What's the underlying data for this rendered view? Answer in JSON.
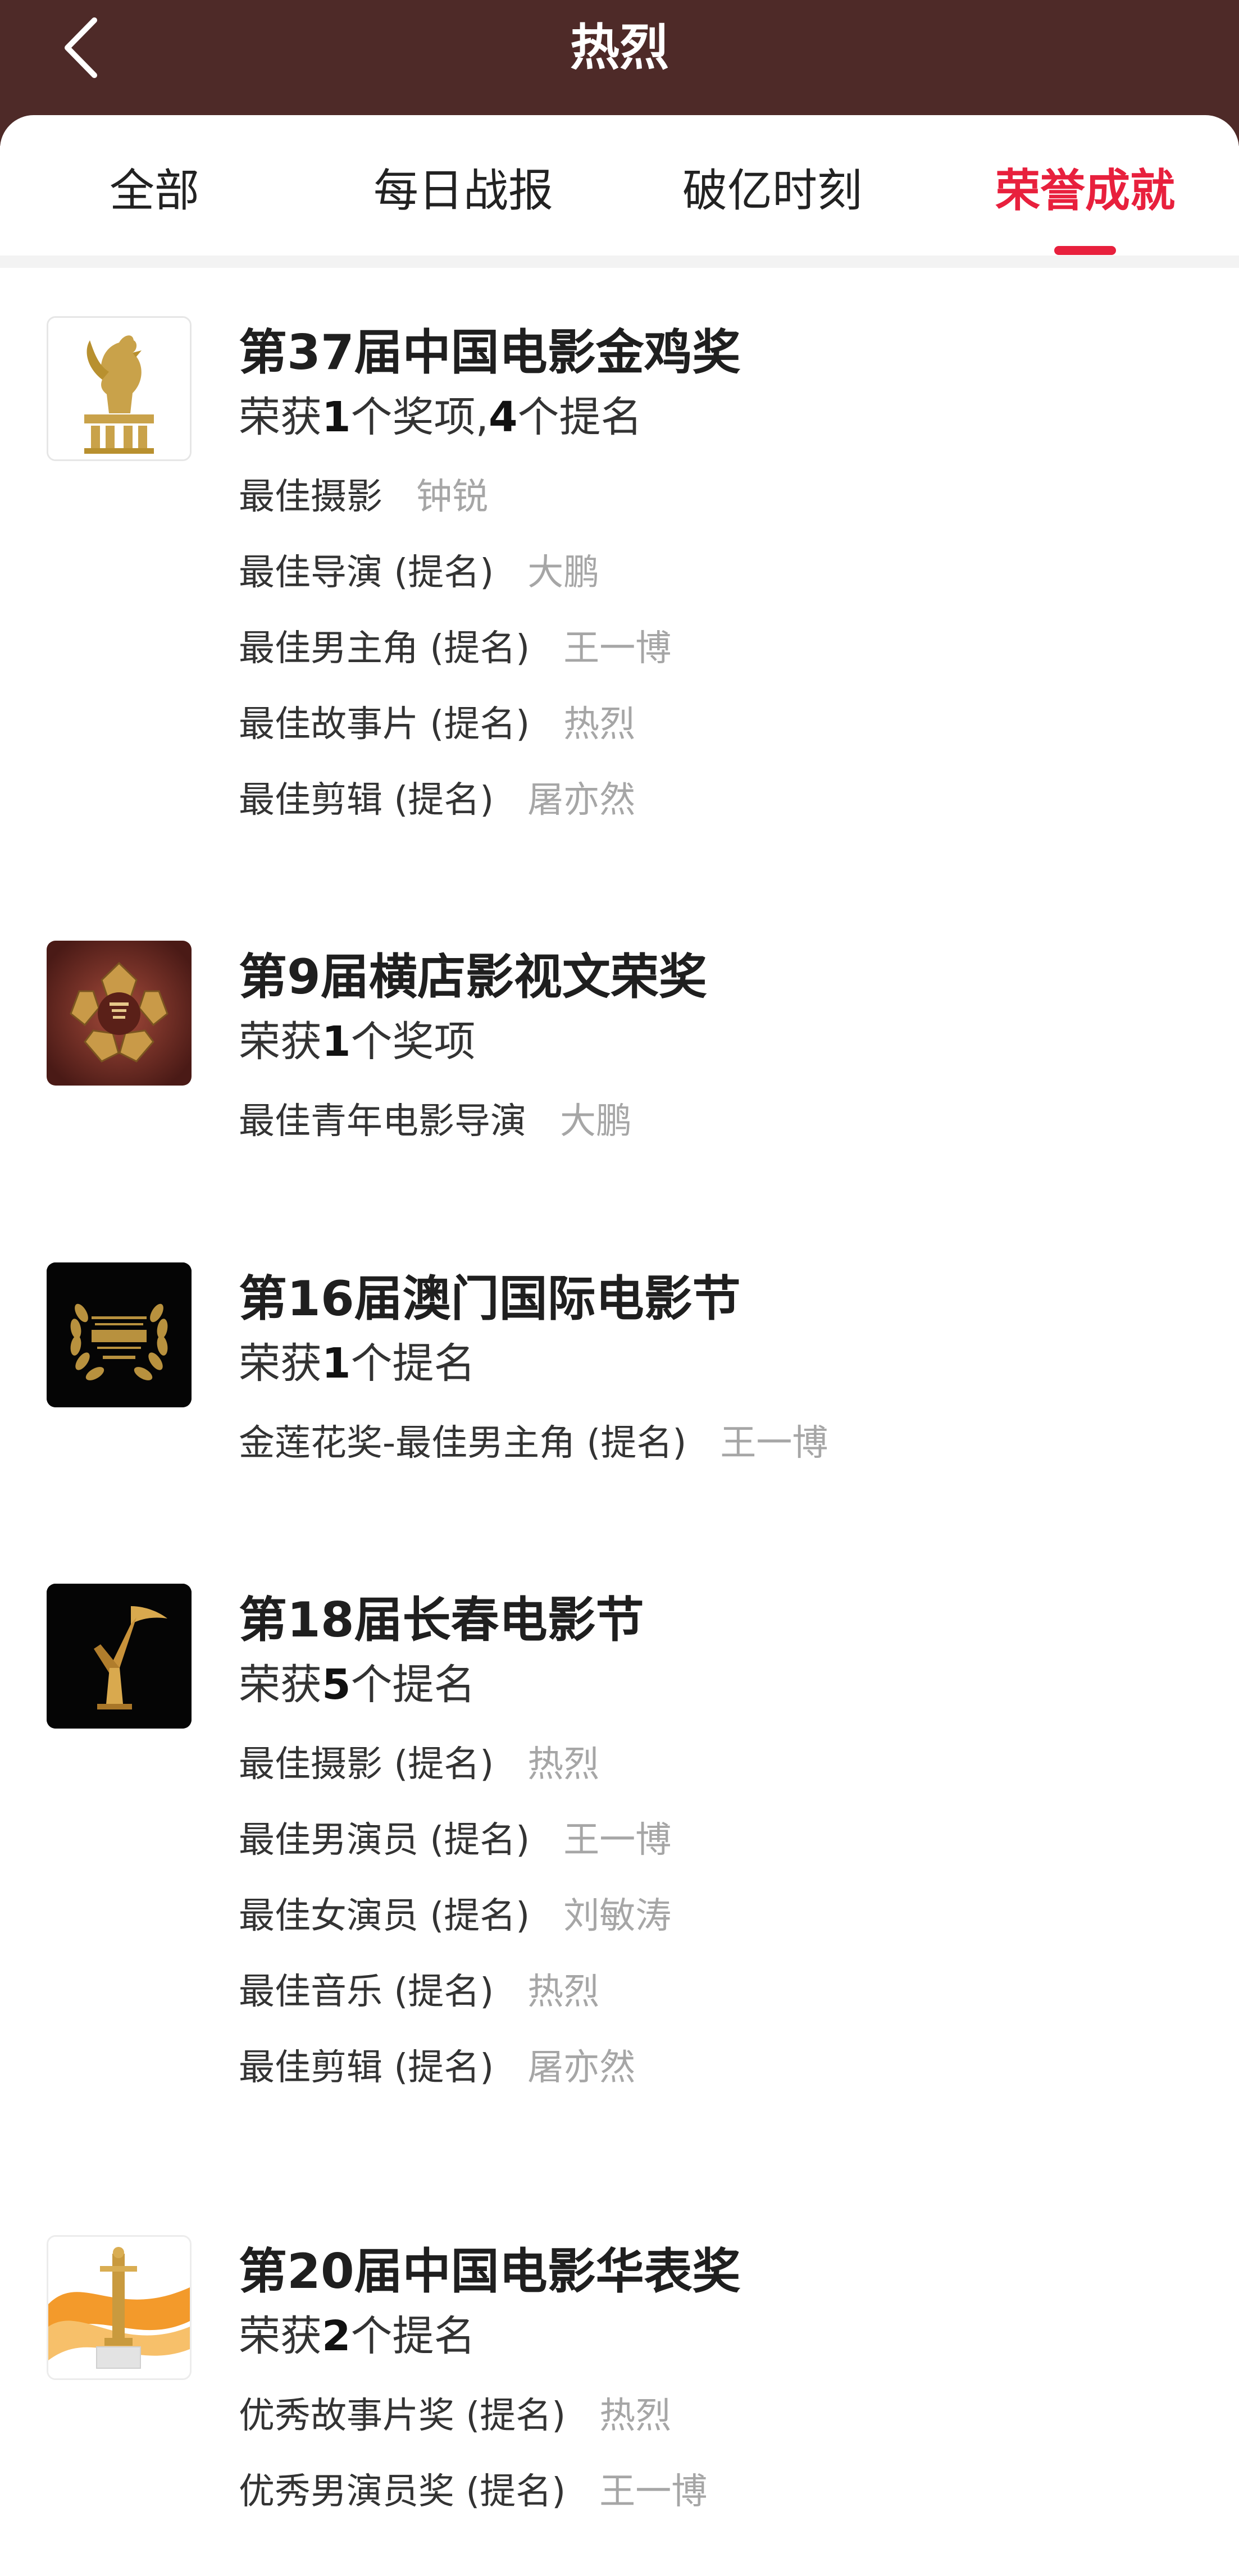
{
  "header": {
    "title": "热烈",
    "back_icon": "chevron-left-icon"
  },
  "tabs": [
    {
      "label": "全部",
      "active": false
    },
    {
      "label": "每日战报",
      "active": false
    },
    {
      "label": "破亿时刻",
      "active": false
    },
    {
      "label": "荣誉成就",
      "active": true
    }
  ],
  "colors": {
    "header_background": "#4e2a28",
    "accent": "#e8203d"
  },
  "awards": [
    {
      "title": "第37届中国电影金鸡奖",
      "summary": {
        "prefix": "荣获",
        "n1": "1",
        "mid": "个奖项,",
        "n2": "4",
        "suffix": "个提名"
      },
      "logo_icon": "golden-rooster-trophy-icon",
      "items": [
        {
          "name": "最佳摄影",
          "person": "钟锐"
        },
        {
          "name": "最佳导演 (提名)",
          "person": "大鹏"
        },
        {
          "name": "最佳男主角 (提名)",
          "person": "王一博"
        },
        {
          "name": "最佳故事片 (提名)",
          "person": "热烈"
        },
        {
          "name": "最佳剪辑 (提名)",
          "person": "屠亦然"
        }
      ]
    },
    {
      "title": "第9届横店影视文荣奖",
      "summary": {
        "prefix": "荣获",
        "n1": "1",
        "suffix": "个奖项"
      },
      "logo_icon": "wenrong-award-emblem-icon",
      "items": [
        {
          "name": "最佳青年电影导演",
          "person": "大鹏"
        }
      ]
    },
    {
      "title": "第16届澳门国际电影节",
      "summary": {
        "prefix": "荣获",
        "n1": "1",
        "suffix": "个提名"
      },
      "logo_icon": "macau-film-festival-laurel-icon",
      "items": [
        {
          "name": "金莲花奖-最佳男主角 (提名)",
          "person": "王一博"
        }
      ]
    },
    {
      "title": "第18届长春电影节",
      "summary": {
        "prefix": "荣获",
        "n1": "5",
        "suffix": "个提名"
      },
      "logo_icon": "changchun-golden-deer-trophy-icon",
      "items": [
        {
          "name": "最佳摄影 (提名)",
          "person": "热烈"
        },
        {
          "name": "最佳男演员 (提名)",
          "person": "王一博"
        },
        {
          "name": "最佳女演员 (提名)",
          "person": "刘敏涛"
        },
        {
          "name": "最佳音乐 (提名)",
          "person": "热烈"
        },
        {
          "name": "最佳剪辑 (提名)",
          "person": "屠亦然"
        }
      ]
    },
    {
      "title": "第20届中国电影华表奖",
      "summary": {
        "prefix": "荣获",
        "n1": "2",
        "suffix": "个提名"
      },
      "logo_icon": "huabiao-pillar-trophy-icon",
      "items": [
        {
          "name": "优秀故事片奖 (提名)",
          "person": "热烈"
        },
        {
          "name": "优秀男演员奖 (提名)",
          "person": "王一博"
        }
      ]
    }
  ]
}
